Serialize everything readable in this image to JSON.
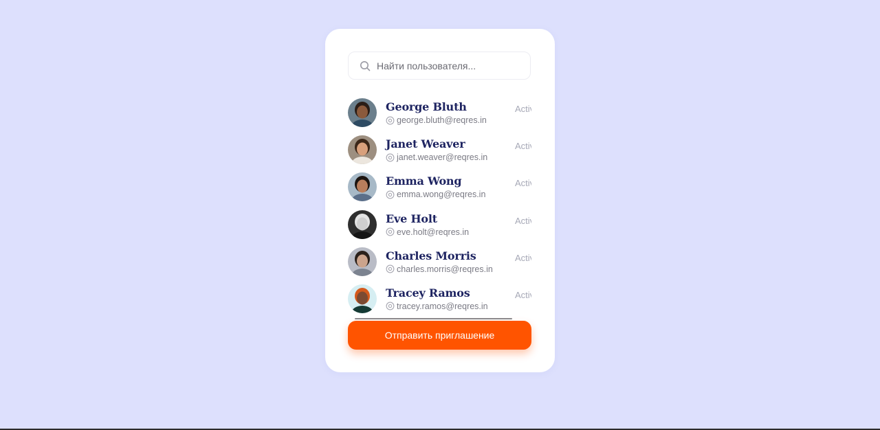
{
  "search": {
    "placeholder": "Найти пользователя...",
    "value": ""
  },
  "users": [
    {
      "name": "George Bluth",
      "email": "george.bluth@reqres.in",
      "status": "Active",
      "avatar_bg": "#6b7f8c",
      "skin": "#8b5a3c",
      "hair": "#2a1d16",
      "shirt": "#2e4b63"
    },
    {
      "name": "Janet Weaver",
      "email": "janet.weaver@reqres.in",
      "status": "Active",
      "avatar_bg": "#9d8f80",
      "skin": "#d8a07c",
      "hair": "#3b2618",
      "shirt": "#ece6de"
    },
    {
      "name": "Emma Wong",
      "email": "emma.wong@reqres.in",
      "status": "Active",
      "avatar_bg": "#a7b9c7",
      "skin": "#b97e5c",
      "hair": "#1c1410",
      "shirt": "#5b6f8a"
    },
    {
      "name": "Eve Holt",
      "email": "eve.holt@reqres.in",
      "status": "Active",
      "avatar_bg": "#2e2e2e",
      "skin": "#cfcfcf",
      "hair": "#e4e4e4",
      "shirt": "#151515"
    },
    {
      "name": "Charles Morris",
      "email": "charles.morris@reqres.in",
      "status": "Active",
      "avatar_bg": "#b9bcc6",
      "skin": "#cca48c",
      "hair": "#2b211b",
      "shirt": "#7c8390"
    },
    {
      "name": "Tracey Ramos",
      "email": "tracey.ramos@reqres.in",
      "status": "Active",
      "avatar_bg": "#d6eef2",
      "skin": "#7a4a32",
      "hair": "#d45a1c",
      "shirt": "#153a34"
    }
  ],
  "invite_button": {
    "label": "Отправить приглашение"
  },
  "colors": {
    "page_background": "#dde0fd",
    "accent": "#ff5400",
    "name_text": "#1e2461",
    "status_text": "#a6a8b6"
  }
}
